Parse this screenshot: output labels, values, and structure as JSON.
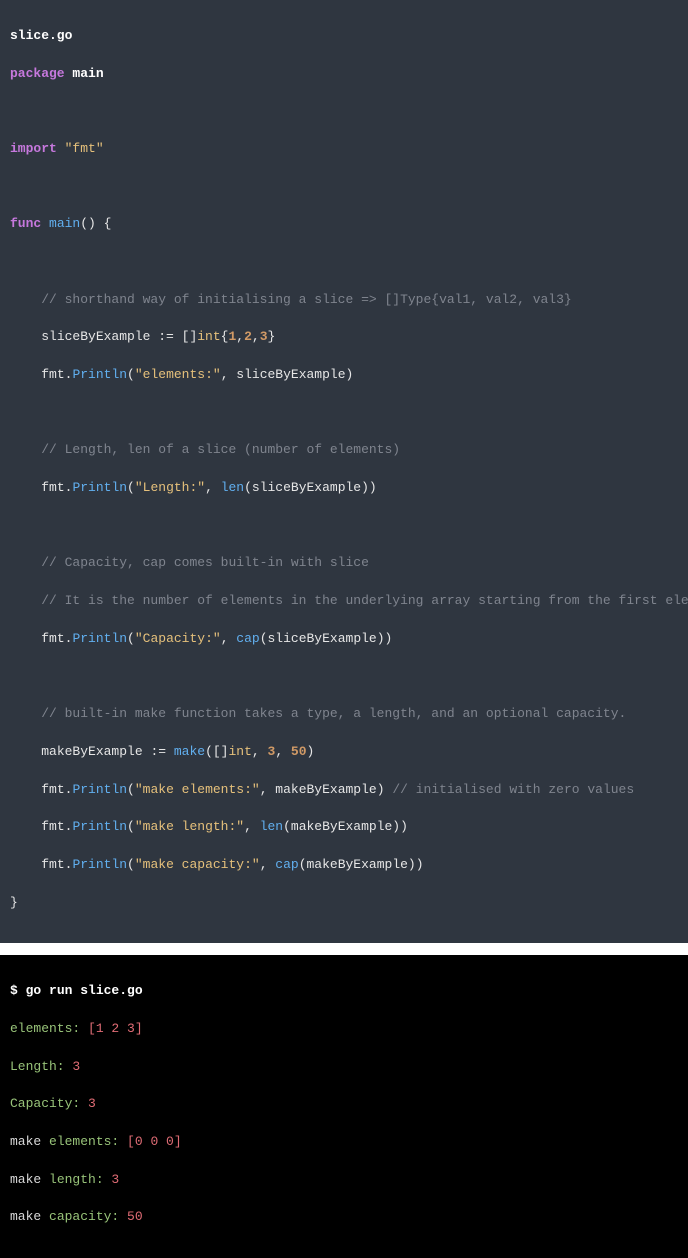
{
  "code": {
    "filename": "slice.go",
    "package_kw": "package",
    "package_name": "main",
    "import_kw": "import",
    "import_pkg": "\"fmt\"",
    "func_kw": "func",
    "func_name": "main",
    "func_parens": "()",
    "brace_open": "{",
    "brace_close": "}",
    "c1": "// shorthand way of initialising a slice => []Type{val1, val2, val3}",
    "l1_id": "sliceByExample",
    "l1_assign": " := []",
    "l1_type": "int",
    "l1_brace_o": "{",
    "l1_n1": "1",
    "l1_c": ",",
    "l1_n2": "2",
    "l1_n3": "3",
    "l1_brace_c": "}",
    "l2_pre": "fmt.",
    "l2_fn": "Println",
    "l2_open": "(",
    "l2_s": "\"elements:\"",
    "l2_rest": ", sliceByExample)",
    "c2": "// Length, len of a slice (number of elements)",
    "l3_pre": "fmt.",
    "l3_fn": "Println",
    "l3_open": "(",
    "l3_s": "\"Length:\"",
    "l3_mid": ", ",
    "l3_len": "len",
    "l3_arg": "(sliceByExample))",
    "c3a": "// Capacity, cap comes built-in with slice",
    "c3b": "// It is the number of elements in the underlying array starting from the first element in the slice",
    "l4_pre": "fmt.",
    "l4_fn": "Println",
    "l4_open": "(",
    "l4_s": "\"Capacity:\"",
    "l4_mid": ", ",
    "l4_cap": "cap",
    "l4_arg": "(sliceByExample))",
    "c4": "// built-in make function takes a type, a length, and an optional capacity.",
    "l5_id": "makeByExample",
    "l5_assign": " := ",
    "l5_make": "make",
    "l5_open": "([]",
    "l5_type": "int",
    "l5_mid": ", ",
    "l5_n1": "3",
    "l5_n2": "50",
    "l5_close": ")",
    "l6_pre": "fmt.",
    "l6_fn": "Println",
    "l6_open": "(",
    "l6_s": "\"make elements:\"",
    "l6_rest": ", makeByExample)",
    "l6_cmt": " // initialised with zero values",
    "l7_pre": "fmt.",
    "l7_fn": "Println",
    "l7_open": "(",
    "l7_s": "\"make length:\"",
    "l7_mid": ", ",
    "l7_len": "len",
    "l7_arg": "(makeByExample))",
    "l8_pre": "fmt.",
    "l8_fn": "Println",
    "l8_open": "(",
    "l8_s": "\"make capacity:\"",
    "l8_mid": ", ",
    "l8_cap": "cap",
    "l8_arg": "(makeByExample))"
  },
  "terminal": {
    "cmd_prompt": "$ ",
    "cmd": "go run slice.go",
    "o1_label": "elements:",
    "o1_val": " [1 2 3]",
    "o2_label": "Length:",
    "o2_val": " 3",
    "o3_label": "Capacity:",
    "o3_val": " 3",
    "o4_pre": "make ",
    "o4_label": "elements:",
    "o4_val": " [0 0 0]",
    "o5_pre": "make ",
    "o5_label": "length:",
    "o5_val": " 3",
    "o6_pre": "make ",
    "o6_label": "capacity:",
    "o6_val": " 50"
  }
}
